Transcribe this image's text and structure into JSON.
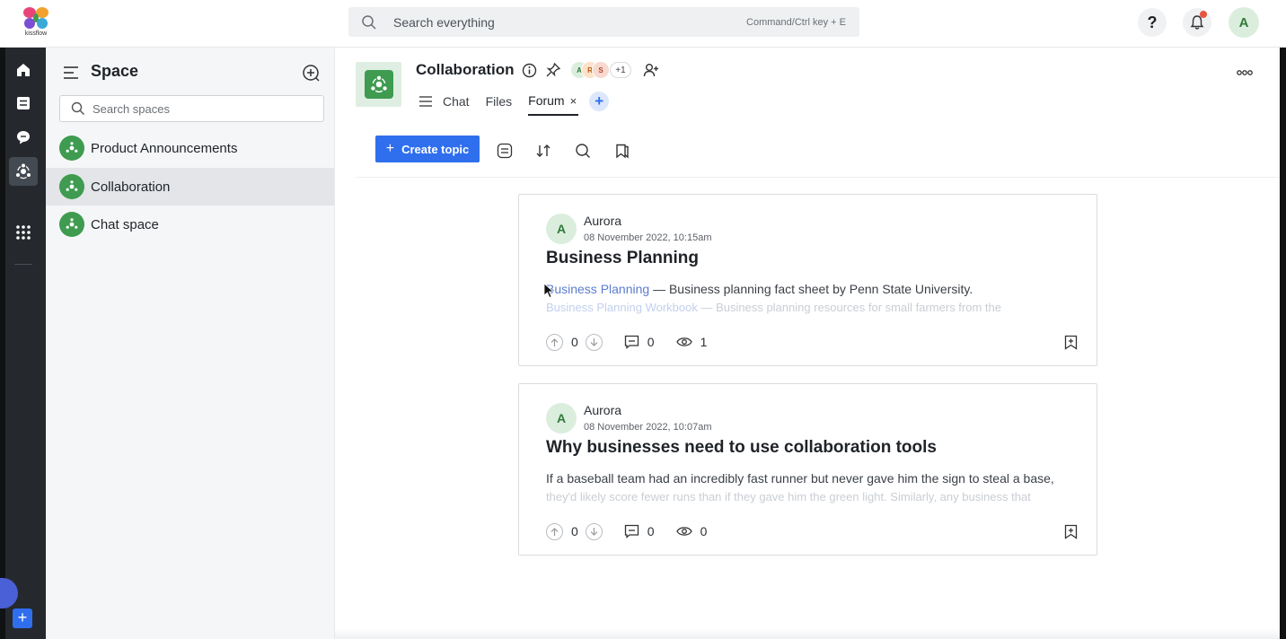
{
  "app": {
    "logo_text": "kissflow"
  },
  "header": {
    "search_placeholder": "Search everything",
    "search_shortcut": "Command/Ctrl key + E",
    "help_label": "?",
    "user_initial": "A"
  },
  "rail": {
    "items": [
      "home-icon",
      "tasks-icon",
      "chat-icon",
      "space-icon",
      "apps-icon"
    ],
    "active": "space-icon",
    "plus_label": "+"
  },
  "space_panel": {
    "title": "Space",
    "search_placeholder": "Search spaces",
    "items": [
      {
        "label": "Product Announcements",
        "active": false
      },
      {
        "label": "Collaboration",
        "active": true
      },
      {
        "label": "Chat space",
        "active": false
      }
    ]
  },
  "channel": {
    "title": "Collaboration",
    "members": [
      {
        "initial": "A",
        "bg": "#dbeedd",
        "fg": "#2f7a3b"
      },
      {
        "initial": "R",
        "bg": "#fde2c9",
        "fg": "#b85a12"
      },
      {
        "initial": "S",
        "bg": "#f7d9cf",
        "fg": "#b2452a"
      }
    ],
    "member_count": "+1",
    "tabs": [
      {
        "label": "Chat",
        "active": false
      },
      {
        "label": "Files",
        "active": false
      },
      {
        "label": "Forum",
        "active": true,
        "close": "×"
      }
    ],
    "tab_add": "+"
  },
  "toolbar": {
    "create_label": "Create topic",
    "create_plus": "+"
  },
  "posts": [
    {
      "avatar": "A",
      "author": "Aurora",
      "date": "08 November 2022, 10:15am",
      "title": "Business Planning",
      "line1_link": "Business Planning",
      "line1_text": " — Business planning fact sheet by Penn State University.",
      "line2_link": "Business Planning Workbook",
      "line2_text": " — Business planning resources for small farmers from the",
      "upvotes": "0",
      "comments": "0",
      "views": "1"
    },
    {
      "avatar": "A",
      "author": "Aurora",
      "date": "08 November 2022, 10:07am",
      "title": "Why businesses need to use collaboration tools",
      "line1_link": "",
      "line1_text": "If a baseball team had an incredibly fast runner but never gave him the sign to steal a base,",
      "line2_link": "",
      "line2_text": "they'd likely score fewer runs than if they gave him the green light. Similarly, any business that",
      "upvotes": "0",
      "comments": "0",
      "views": "0"
    }
  ],
  "colors": {
    "accent": "#2f6fed",
    "space_green": "#3e9b50",
    "rail_bg": "#25292e"
  }
}
